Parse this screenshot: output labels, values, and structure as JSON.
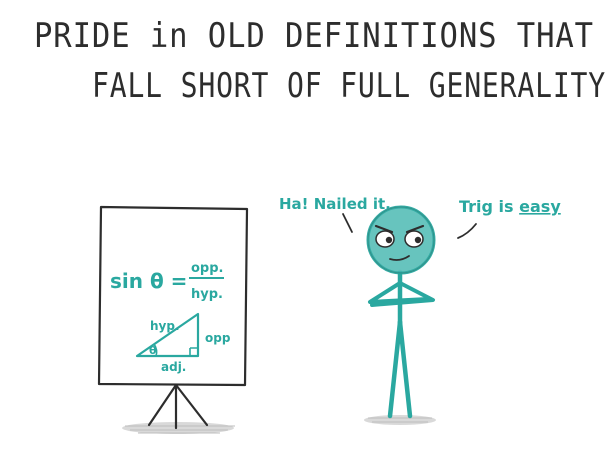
{
  "caption": {
    "line1": "PRIDE in OLD DEFINITIONS THAT",
    "line2": "FALL SHORT OF FULL GENERALITY"
  },
  "speech": {
    "left": "Ha! Nailed it.",
    "right_prefix": "Trig is ",
    "right_emphasis": "easy"
  },
  "board": {
    "formula_left": "sin θ =",
    "formula_numerator": "opp.",
    "formula_denominator": "hyp.",
    "label_hyp": "hyp.",
    "label_opp": "opp",
    "label_adj": "adj.",
    "label_theta": "θ"
  },
  "icons": {
    "easel": "easel-icon",
    "stick_figure": "stick-figure-icon"
  },
  "colors": {
    "ink": "#2d2d2d",
    "teal": "#2aa8a0",
    "shadow": "#c8c8c8"
  }
}
